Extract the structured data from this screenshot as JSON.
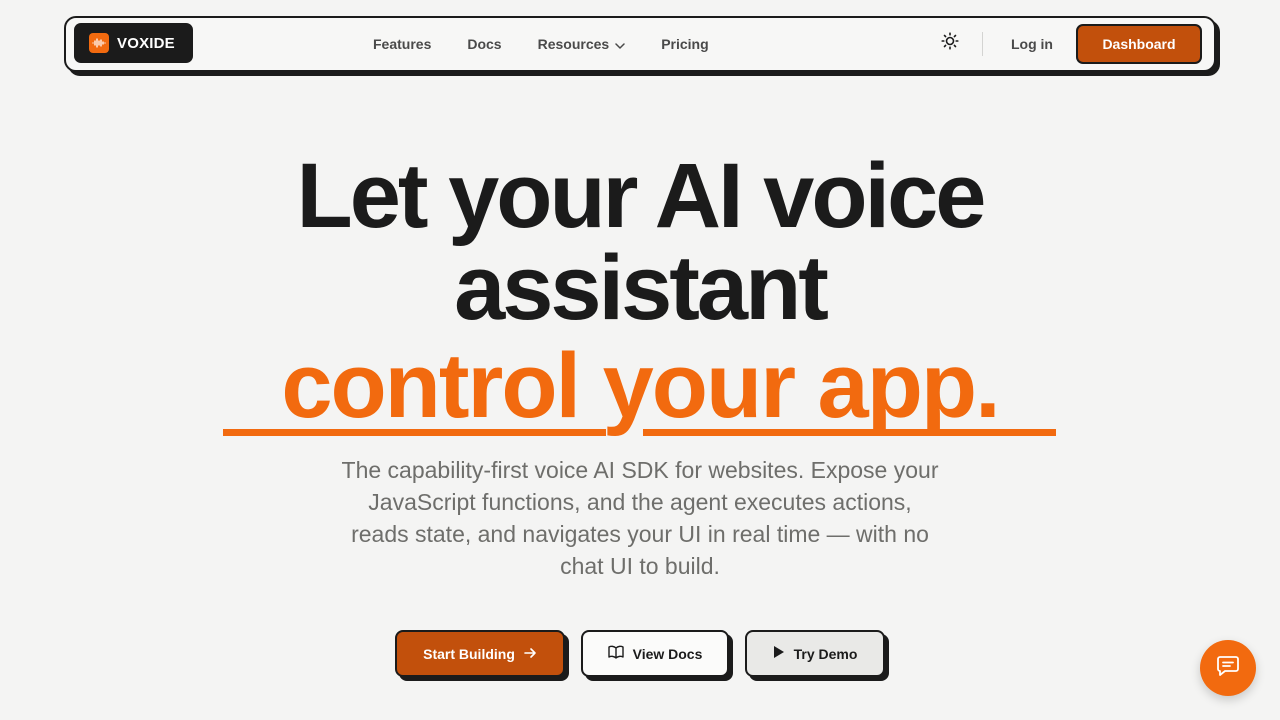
{
  "brand": {
    "name": "VOXIDE",
    "icon": "sound-wave-icon",
    "accent_color": "#f26a0f",
    "button_color": "#c2500c"
  },
  "nav": {
    "links": [
      {
        "label": "Features"
      },
      {
        "label": "Docs"
      },
      {
        "label": "Resources",
        "icon": "chevron-down-icon"
      },
      {
        "label": "Pricing"
      }
    ],
    "theme_toggle_icon": "sun-icon",
    "login_label": "Log in",
    "dashboard_label": "Dashboard"
  },
  "hero": {
    "line1": "Let your AI voice",
    "line2": "assistant",
    "accent": "control your app.",
    "subtitle": "The capability-first voice AI SDK for websites. Expose your JavaScript functions, and the agent executes actions, reads state, and navigates your UI in real time — with no chat UI to build."
  },
  "cta": {
    "start_label": "Start Building",
    "start_icon": "arrow-right-icon",
    "docs_label": "View Docs",
    "docs_icon": "book-icon",
    "demo_label": "Try Demo",
    "demo_icon": "play-icon"
  },
  "chat_widget": {
    "icon": "chat-bubble-icon"
  }
}
